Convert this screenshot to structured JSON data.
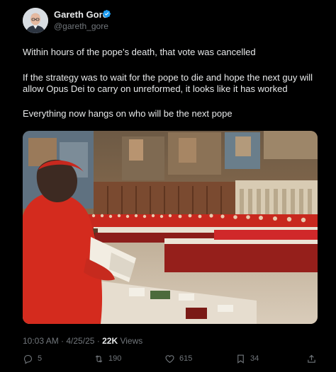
{
  "author": {
    "display_name": "Gareth Gore",
    "handle": "@gareth_gore",
    "verified_icon": "verified-badge-icon",
    "verified_color": "#1d9bf0"
  },
  "post": {
    "paragraph_1": "Within hours of the pope’s death, that vote was cancelled",
    "paragraph_2": "If the strategy was to wait for the pope to die and hope the next guy will allow Opus Dei to carry on unreformed, it looks like it has worked",
    "paragraph_3": "Everything now hangs on who will be the next pope"
  },
  "meta": {
    "time": "10:03 AM",
    "separator": " · ",
    "date": "4/25/25",
    "views_count": "22K",
    "views_label": " Views"
  },
  "actions": {
    "replies": "5",
    "reposts": "190",
    "likes": "615",
    "bookmarks": "34"
  },
  "colors": {
    "background": "#000000",
    "text_primary": "#e7e9ea",
    "text_secondary": "#71767b"
  }
}
